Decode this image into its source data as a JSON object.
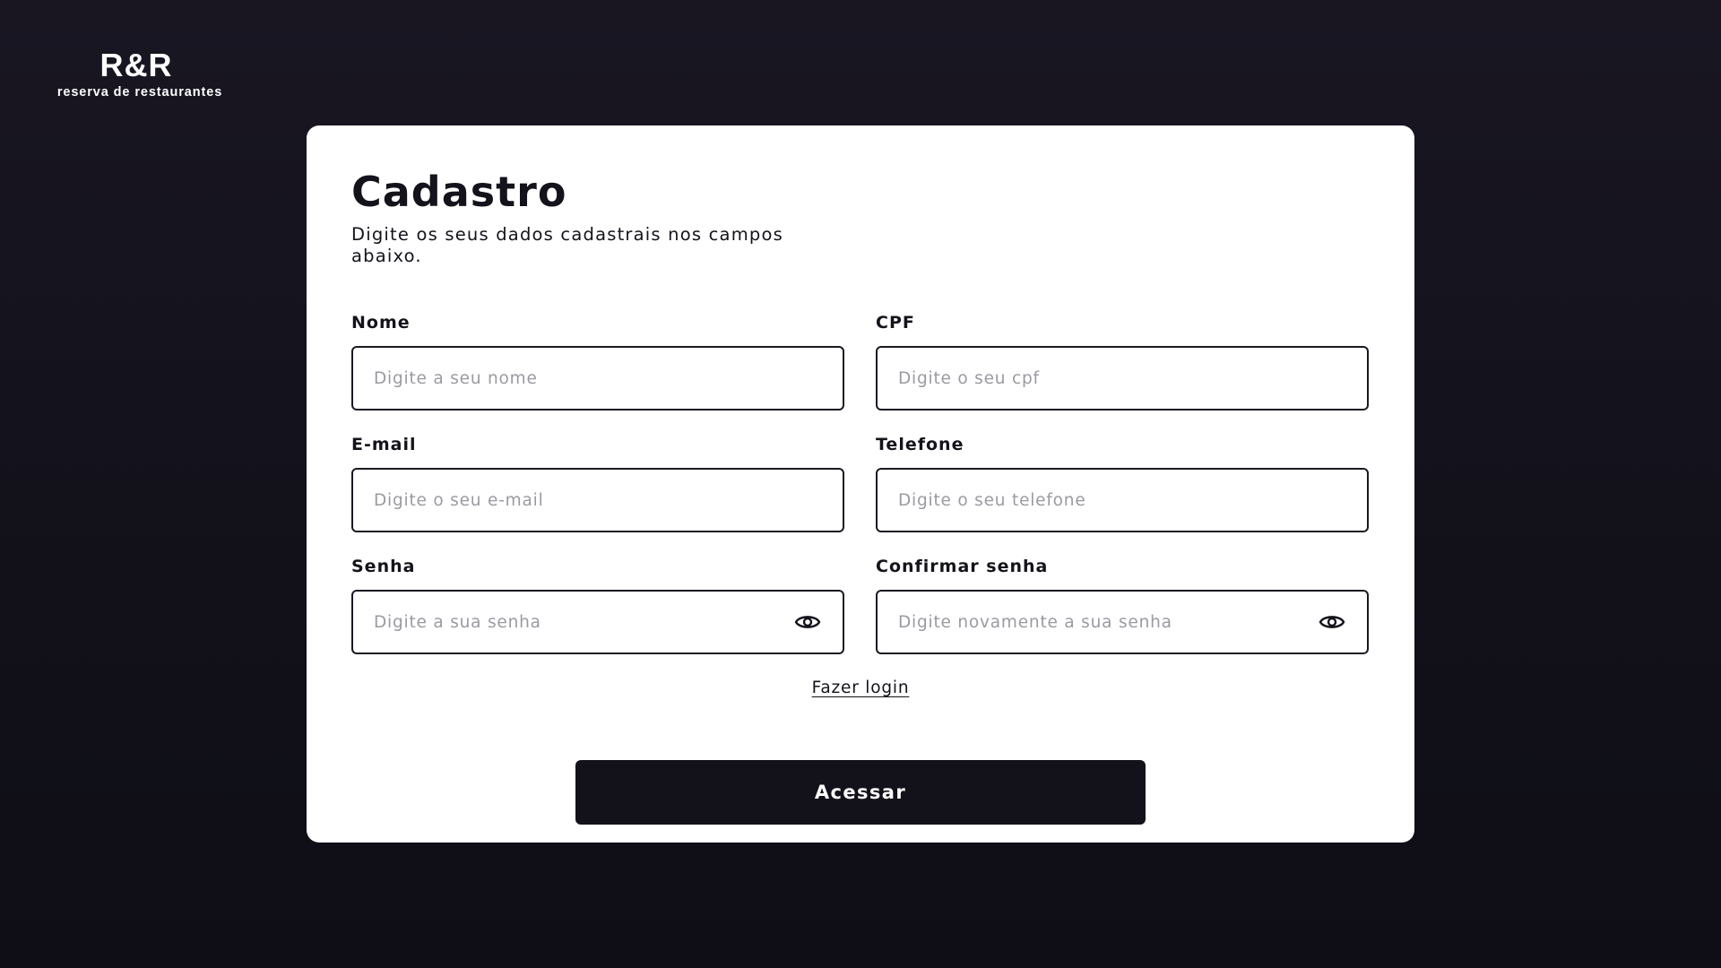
{
  "brand": {
    "title": "R&R",
    "subtitle": "reserva de restaurantes"
  },
  "form": {
    "title": "Cadastro",
    "subtitle": "Digite os seus dados cadastrais nos campos abaixo.",
    "fields": {
      "nome": {
        "label": "Nome",
        "placeholder": "Digite a seu nome",
        "value": ""
      },
      "cpf": {
        "label": "CPF",
        "placeholder": "Digite o seu cpf",
        "value": ""
      },
      "email": {
        "label": "E-mail",
        "placeholder": "Digite o seu e-mail",
        "value": ""
      },
      "telefone": {
        "label": "Telefone",
        "placeholder": "Digite o seu telefone",
        "value": ""
      },
      "senha": {
        "label": "Senha",
        "placeholder": "Digite a sua senha",
        "value": "",
        "icon": "eye-icon"
      },
      "confirmar_senha": {
        "label": "Confirmar senha",
        "placeholder": "Digite novamente a sua senha",
        "value": "",
        "icon": "eye-icon"
      }
    },
    "login_link": "Fazer login",
    "submit_label": "Acessar"
  },
  "colors": {
    "background": "#15131d",
    "card": "#ffffff",
    "text": "#14131b",
    "button": "#13121a",
    "placeholder": "#9a9aa2"
  }
}
